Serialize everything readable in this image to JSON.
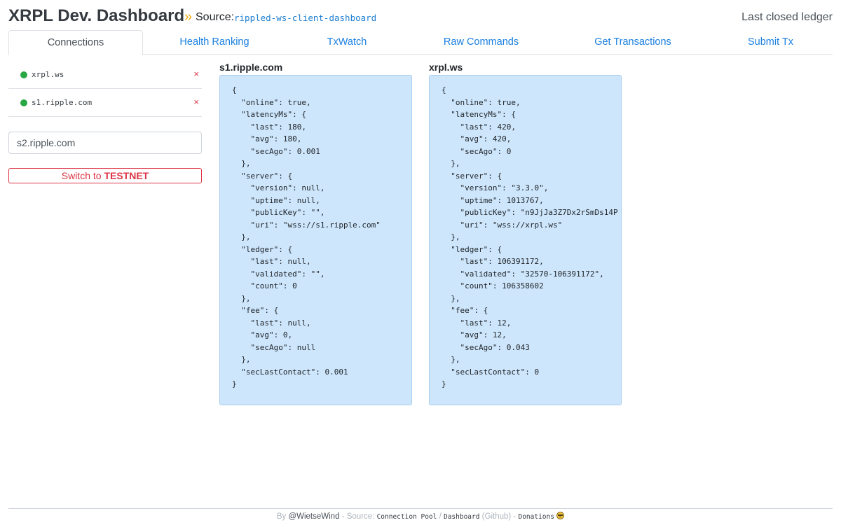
{
  "header": {
    "title": "XRPL Dev. Dashboard",
    "separator": "»",
    "source_label": "Source:",
    "source_name": "rippled-ws-client-dashboard",
    "right_label": "Last closed ledger"
  },
  "tabs": [
    {
      "label": "Connections",
      "active": true
    },
    {
      "label": "Health Ranking",
      "active": false
    },
    {
      "label": "TxWatch",
      "active": false
    },
    {
      "label": "Raw Commands",
      "active": false
    },
    {
      "label": "Get Transactions",
      "active": false
    },
    {
      "label": "Submit Tx",
      "active": false
    }
  ],
  "sidebar": {
    "connections": [
      {
        "name": "xrpl.ws",
        "status": "online",
        "status_color": "#28a745",
        "close_label": "×"
      },
      {
        "name": "s1.ripple.com",
        "status": "online",
        "status_color": "#28a745",
        "close_label": "×"
      }
    ],
    "server_input": {
      "value": "s2.ripple.com",
      "placeholder": ""
    },
    "switch_button": {
      "prefix": "Switch to ",
      "network": "TESTNET"
    }
  },
  "panels": [
    {
      "title": "s1.ripple.com",
      "json": "{\n  \"online\": true,\n  \"latencyMs\": {\n    \"last\": 180,\n    \"avg\": 180,\n    \"secAgo\": 0.001\n  },\n  \"server\": {\n    \"version\": null,\n    \"uptime\": null,\n    \"publicKey\": \"\",\n    \"uri\": \"wss://s1.ripple.com\"\n  },\n  \"ledger\": {\n    \"last\": null,\n    \"validated\": \"\",\n    \"count\": 0\n  },\n  \"fee\": {\n    \"last\": null,\n    \"avg\": 0,\n    \"secAgo\": null\n  },\n  \"secLastContact\": 0.001\n}"
    },
    {
      "title": "xrpl.ws",
      "json": "{\n  \"online\": true,\n  \"latencyMs\": {\n    \"last\": 420,\n    \"avg\": 420,\n    \"secAgo\": 0\n  },\n  \"server\": {\n    \"version\": \"3.3.0\",\n    \"uptime\": 1013767,\n    \"publicKey\": \"n9JjJa3Z7Dx2rSmDs14P\n    \"uri\": \"wss://xrpl.ws\"\n  },\n  \"ledger\": {\n    \"last\": 106391172,\n    \"validated\": \"32570-106391172\",\n    \"count\": 106358602\n  },\n  \"fee\": {\n    \"last\": 12,\n    \"avg\": 12,\n    \"secAgo\": 0.043\n  },\n  \"secLastContact\": 0\n}"
    }
  ],
  "footer": {
    "by": "By",
    "author": "@WietseWind",
    "dash1": "-",
    "source_label": "Source:",
    "link1": "Connection Pool",
    "slash": "/",
    "link2": "Dashboard",
    "github": "(Github)",
    "dash2": "-",
    "link3": "Donations"
  }
}
